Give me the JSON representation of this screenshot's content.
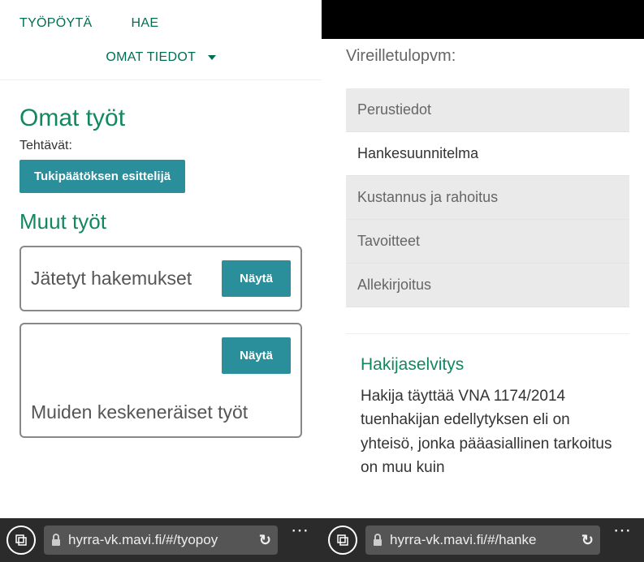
{
  "left": {
    "nav": {
      "desktop": "TYÖPÖYTÄ",
      "search": "HAE",
      "own_info": "OMAT TIEDOT"
    },
    "heading_own_work": "Omat työt",
    "tasks_label": "Tehtävät:",
    "task_button": "Tukipäätöksen esittelijä",
    "heading_other_work": "Muut työt",
    "card1": {
      "title": "Jätetyt hakemukset",
      "show": "Näytä"
    },
    "card2": {
      "title": "Muiden keskeneräiset työt",
      "show": "Näytä"
    },
    "url": "hyrra-vk.mavi.fi/#/tyopoy"
  },
  "right": {
    "field_label": "Vireilletulopvm:",
    "tabs": {
      "t1": "Perustiedot",
      "t2": "Hankesuunnitelma",
      "t3": "Kustannus ja rahoitus",
      "t4": "Tavoitteet",
      "t5": "Allekirjoitus"
    },
    "section_title": "Hakijaselvitys",
    "section_text": "Hakija täyttää VNA 1174/2014 tuenhakijan edellytyksen eli on yhteisö, jonka pääasiallinen tarkoitus on muu kuin",
    "url": "hyrra-vk.mavi.fi/#/hanke"
  }
}
